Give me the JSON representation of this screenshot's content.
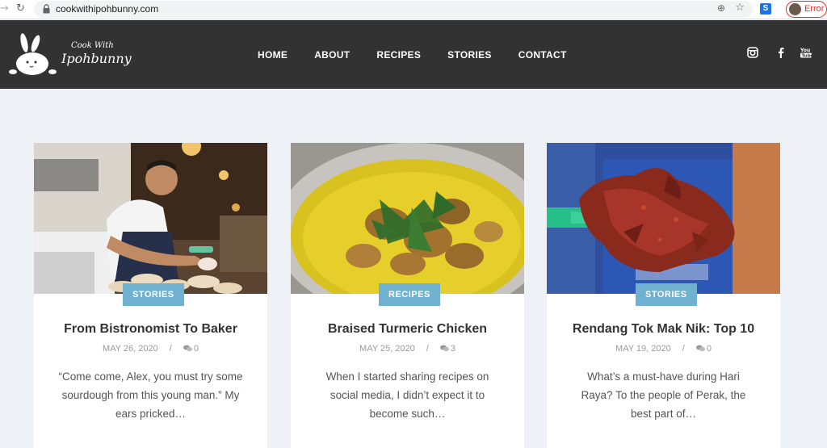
{
  "browser": {
    "url": "cookwithipohbunny.com",
    "profile_status": "Error"
  },
  "site": {
    "logo_small": "Cook With",
    "logo_big": "Ipohbunny"
  },
  "nav": {
    "items": [
      {
        "label": "HOME"
      },
      {
        "label": "ABOUT"
      },
      {
        "label": "RECIPES"
      },
      {
        "label": "STORIES"
      },
      {
        "label": "CONTACT"
      }
    ]
  },
  "social": [
    "instagram-icon",
    "facebook-icon",
    "youtube-icon"
  ],
  "colors": {
    "header_bg": "#323232",
    "page_bg": "#eef2f6",
    "badge": "#6fb1ce",
    "error": "#d93025"
  },
  "posts": [
    {
      "category": "STORIES",
      "title": "From Bistronomist To Baker",
      "date": "MAY 26, 2020",
      "comments": "0",
      "excerpt": "“Come come, Alex, you must try some sourdough from this young man.” My ears pricked…"
    },
    {
      "category": "RECIPES",
      "title": "Braised Turmeric Chicken",
      "date": "MAY 25, 2020",
      "comments": "3",
      "excerpt": "When I started sharing recipes on social media, I didn’t expect it to become such…"
    },
    {
      "category": "STORIES",
      "title": "Rendang Tok Mak Nik: Top 10",
      "date": "MAY 19, 2020",
      "comments": "0",
      "excerpt": "What’s a must-have during Hari Raya? To the people of Perak, the best part of…"
    }
  ]
}
